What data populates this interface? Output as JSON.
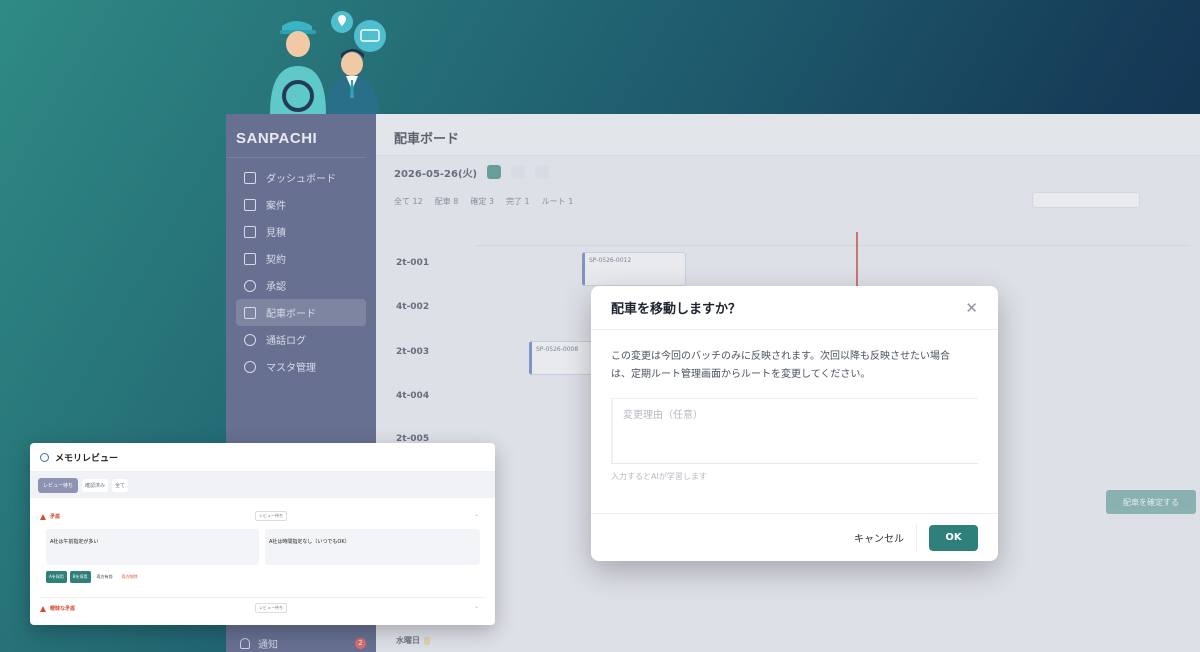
{
  "app": {
    "brand": "SANPACHI",
    "nav": [
      {
        "label": "ダッシュボード",
        "icon": "grid-icon"
      },
      {
        "label": "案件",
        "icon": "briefcase-icon"
      },
      {
        "label": "見積",
        "icon": "document-icon"
      },
      {
        "label": "契約",
        "icon": "contract-icon"
      },
      {
        "label": "承認",
        "icon": "check-circle-icon"
      },
      {
        "label": "配車ボード",
        "icon": "truck-icon",
        "active": true
      },
      {
        "label": "通話ログ",
        "icon": "phone-icon"
      },
      {
        "label": "マスタ管理",
        "icon": "database-icon"
      }
    ],
    "notify_label": "通知",
    "notify_count": "2",
    "page_title": "配車ボード",
    "date": "2026-05-26(火)",
    "filter_all": "全て 12",
    "filter_tags": [
      "配車 8",
      "確定 3",
      "完了 1",
      "ルート 1"
    ],
    "rows": [
      {
        "id": "2t-001"
      },
      {
        "id": "4t-002"
      },
      {
        "id": "2t-003"
      },
      {
        "id": "4t-004"
      },
      {
        "id": "2t-005"
      }
    ],
    "cards": [
      "SP-0526-0012",
      "SP-0526-0008"
    ],
    "confirm_label": "配車を確定する",
    "weekday": "水曜日"
  },
  "modal": {
    "title": "配車を移動しますか？",
    "body_line1": "この変更は今回のバッチのみに反映されます。次回以降も反映させたい場合",
    "body_line2": "は、定期ルート管理画面からルートを変更してください。",
    "reason_placeholder": "変更理由（任意）",
    "hint": "入力するとAIが学習します",
    "cancel_label": "キャンセル",
    "ok_label": "OK"
  },
  "memo": {
    "title": "メモリレビュー",
    "tabs": [
      "レビュー待ち",
      "確認済み",
      "全て"
    ],
    "section1_title": "矛盾",
    "section1_status": "レビュー待ち",
    "card1_text": "A社は午前指定が多い",
    "card2_text": "A社は時間指定なし（いつでもOK）",
    "actions": [
      "Aを採用",
      "Bを採用",
      "両方有効",
      "両方削除"
    ],
    "section2_title": "曖昧な矛盾",
    "section2_status": "レビュー待ち"
  }
}
